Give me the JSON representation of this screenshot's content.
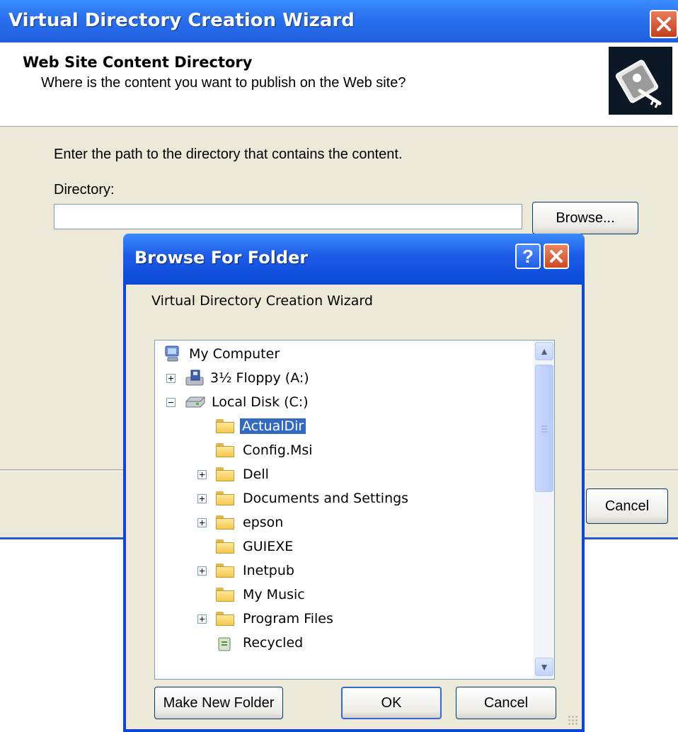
{
  "wizard": {
    "title": "Virtual Directory Creation Wizard",
    "heading": "Web Site Content Directory",
    "subheading": "Where is the content you want to publish on the Web site?",
    "instruction": "Enter the path to the directory that contains the content.",
    "directory_label": "Directory:",
    "directory_value": "",
    "browse_label": "Browse...",
    "cancel_label": "Cancel"
  },
  "dialog": {
    "title": "Browse For Folder",
    "help_symbol": "?",
    "caption": "Virtual Directory Creation Wizard",
    "tree": [
      {
        "label": "My Computer",
        "icon": "computer-icon",
        "expander": "none",
        "selected": false
      },
      {
        "label": "3½ Floppy (A:)",
        "icon": "floppy-drive-icon",
        "expander": "plus",
        "selected": false
      },
      {
        "label": "Local Disk (C:)",
        "icon": "hard-disk-icon",
        "expander": "minus",
        "selected": false
      },
      {
        "label": "ActualDir",
        "icon": "folder-icon",
        "expander": "none",
        "selected": true
      },
      {
        "label": "Config.Msi",
        "icon": "folder-icon",
        "expander": "none",
        "selected": false
      },
      {
        "label": "Dell",
        "icon": "folder-icon",
        "expander": "plus",
        "selected": false
      },
      {
        "label": "Documents and Settings",
        "icon": "folder-icon",
        "expander": "plus",
        "selected": false
      },
      {
        "label": "epson",
        "icon": "folder-icon",
        "expander": "plus",
        "selected": false
      },
      {
        "label": "GUIEXE",
        "icon": "folder-icon",
        "expander": "none",
        "selected": false
      },
      {
        "label": "Inetpub",
        "icon": "folder-icon",
        "expander": "plus",
        "selected": false
      },
      {
        "label": "My Music",
        "icon": "folder-icon",
        "expander": "none",
        "selected": false
      },
      {
        "label": "Program Files",
        "icon": "folder-icon",
        "expander": "plus",
        "selected": false
      },
      {
        "label": "Recycled",
        "icon": "recycle-bin-icon",
        "expander": "none",
        "selected": false
      }
    ],
    "make_new_folder_label": "Make New Folder",
    "ok_label": "OK",
    "cancel_label": "Cancel"
  },
  "colors": {
    "titlebar_blue": "#1f5fe0",
    "dialog_face": "#ece9d8",
    "selection": "#316ac5",
    "close_red": "#cf4a24"
  }
}
